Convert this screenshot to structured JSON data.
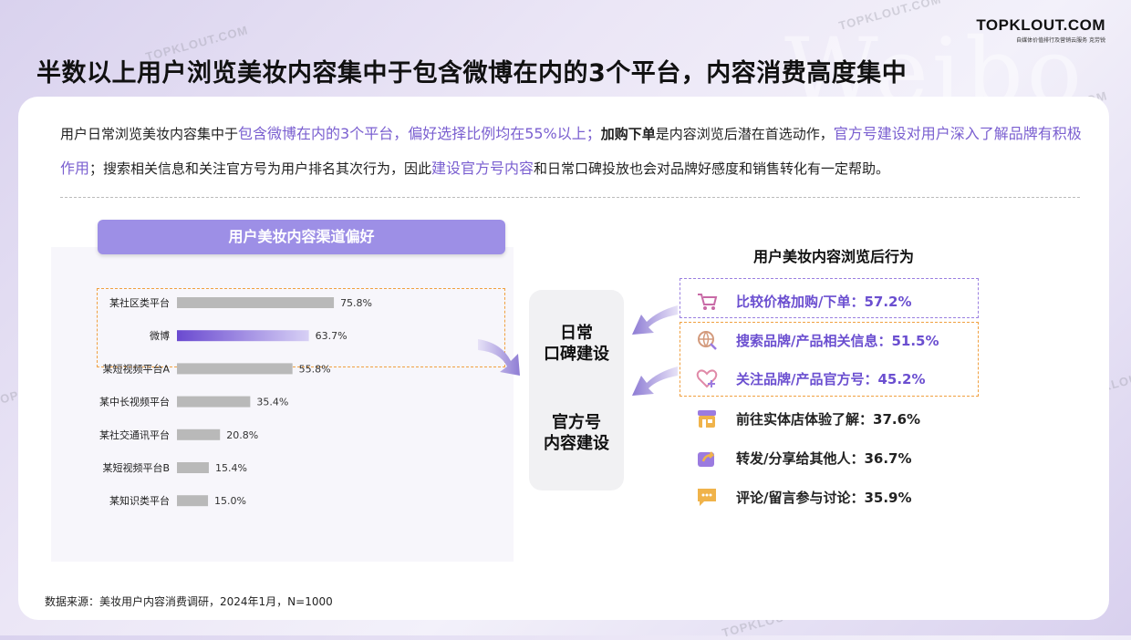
{
  "header": {
    "title": "半数以上用户浏览美妆内容集中于包含微博在内的3个平台，内容消费高度集中",
    "logo_text": "TOPKLOUT.COM",
    "logo_sub": "自媒体价值排行及营销云服务 克劳锐",
    "bg_word": "Weibo",
    "watermark": "TOPKLOUT.COM"
  },
  "description": {
    "p1": "用户日常浏览美妆内容集中于",
    "h1": "包含微博在内的3个平台，偏好选择比例均在55%以上；",
    "p2": "加购下单",
    "p3": "是内容浏览后潜在首选动作，",
    "h2": "官方号建设对用户深入了解品牌有积极作用",
    "p4": "；搜索相关信息和关注官方号为用户排名其次行为，因此",
    "h3": "建设官方号内容",
    "p5": "和日常口碑投放也会对品牌好感度和销售转化有一定帮助。"
  },
  "left_panel": {
    "header": "用户美妆内容渠道偏好"
  },
  "chart_data": {
    "type": "bar",
    "orientation": "horizontal",
    "categories": [
      "某社区类平台",
      "微博",
      "某短视频平台A",
      "某中长视频平台",
      "某社交通讯平台",
      "某短视频平台B",
      "某知识类平台"
    ],
    "values": [
      75.8,
      63.7,
      55.8,
      35.4,
      20.8,
      15.4,
      15.0
    ],
    "labels": [
      "75.8%",
      "63.7%",
      "55.8%",
      "35.4%",
      "20.8%",
      "15.4%",
      "15.0%"
    ],
    "highlight": "微博",
    "colors": {
      "bar": "#b9b9b9",
      "highlight_from": "#6a4ad0",
      "highlight_to": "#d7d0f5"
    }
  },
  "middle": {
    "block1": [
      "日常",
      "口碑建设"
    ],
    "block2": [
      "官方号",
      "内容建设"
    ]
  },
  "right_panel": {
    "header": "用户美妆内容浏览后行为",
    "items": [
      {
        "icon": "cart-icon",
        "label": "比较价格加购/下单：57.2%",
        "highlight": true
      },
      {
        "icon": "globe-search-icon",
        "label": "搜索品牌/产品相关信息：51.5%",
        "highlight": true
      },
      {
        "icon": "heart-plus-icon",
        "label": "关注品牌/产品官方号：45.2%",
        "highlight": true
      },
      {
        "icon": "store-icon",
        "label": "前往实体店体验了解：37.6%",
        "highlight": false
      },
      {
        "icon": "share-icon",
        "label": "转发/分享给其他人：36.7%",
        "highlight": false
      },
      {
        "icon": "comment-icon",
        "label": "评论/留言参与讨论：35.9%",
        "highlight": false
      }
    ]
  },
  "footer": {
    "source": "数据来源：美妆用户内容消费调研，2024年1月，N=1000"
  },
  "colors": {
    "accent": "#7a5fd0",
    "orange": "#f0a040",
    "header_bg": "#9d8fe6"
  }
}
